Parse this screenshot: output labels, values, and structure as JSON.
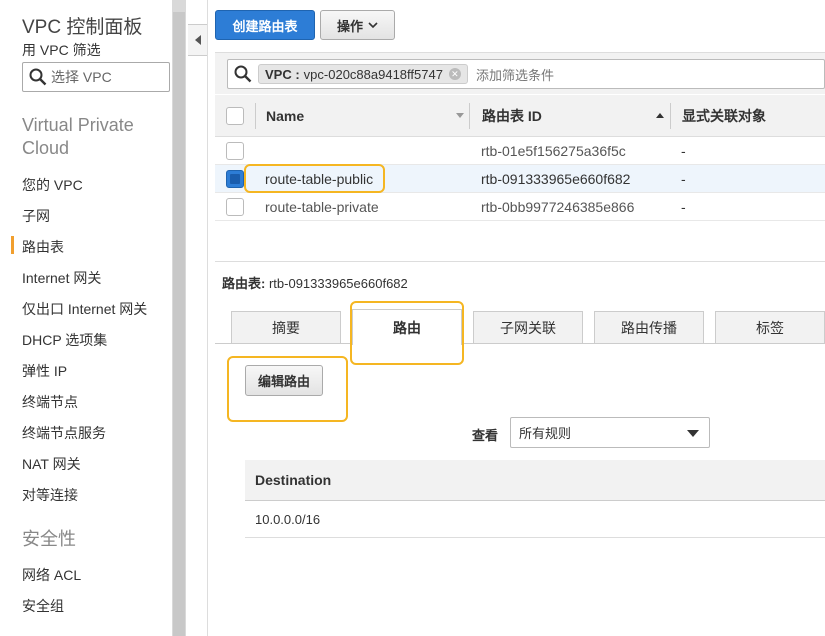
{
  "sidebar": {
    "title": "VPC 控制面板",
    "filter_label": "用 VPC 筛选",
    "search_placeholder": "选择 VPC",
    "section_vpc": "Virtual Private Cloud",
    "items": [
      {
        "label": "您的 VPC"
      },
      {
        "label": "子网"
      },
      {
        "label": "路由表",
        "active": true
      },
      {
        "label": "Internet 网关"
      },
      {
        "label": "仅出口 Internet 网关"
      },
      {
        "label": "DHCP 选项集"
      },
      {
        "label": "弹性 IP"
      },
      {
        "label": "终端节点"
      },
      {
        "label": "终端节点服务"
      },
      {
        "label": "NAT 网关"
      },
      {
        "label": "对等连接"
      }
    ],
    "section_security": "安全性",
    "security_items": [
      {
        "label": "网络 ACL"
      },
      {
        "label": "安全组"
      }
    ]
  },
  "toolbar": {
    "create_label": "创建路由表",
    "actions_label": "操作"
  },
  "filter": {
    "chip_key": "VPC :",
    "chip_value": "vpc-020c88a9418ff5747",
    "placeholder": "添加筛选条件"
  },
  "table": {
    "columns": [
      "Name",
      "路由表 ID",
      "显式关联对象"
    ],
    "rows": [
      {
        "name": "",
        "id": "rtb-01e5f156275a36f5c",
        "assoc": "-",
        "selected": false
      },
      {
        "name": "route-table-public",
        "id": "rtb-091333965e660f682",
        "assoc": "-",
        "selected": true
      },
      {
        "name": "route-table-private",
        "id": "rtb-0bb9977246385e866",
        "assoc": "-",
        "selected": false
      }
    ]
  },
  "detail": {
    "label": "路由表:",
    "value": "rtb-091333965e660f682"
  },
  "tabs": [
    {
      "label": "摘要"
    },
    {
      "label": "路由",
      "active": true
    },
    {
      "label": "子网关联"
    },
    {
      "label": "路由传播"
    },
    {
      "label": "标签"
    }
  ],
  "routes": {
    "edit_label": "编辑路由",
    "view_label": "查看",
    "view_value": "所有规则",
    "column": "Destination",
    "rows": [
      {
        "destination": "10.0.0.0/16"
      }
    ]
  },
  "colors": {
    "accent": "#2d7dd6",
    "highlight": "#f5b622",
    "active_marker": "#f19f2e"
  }
}
